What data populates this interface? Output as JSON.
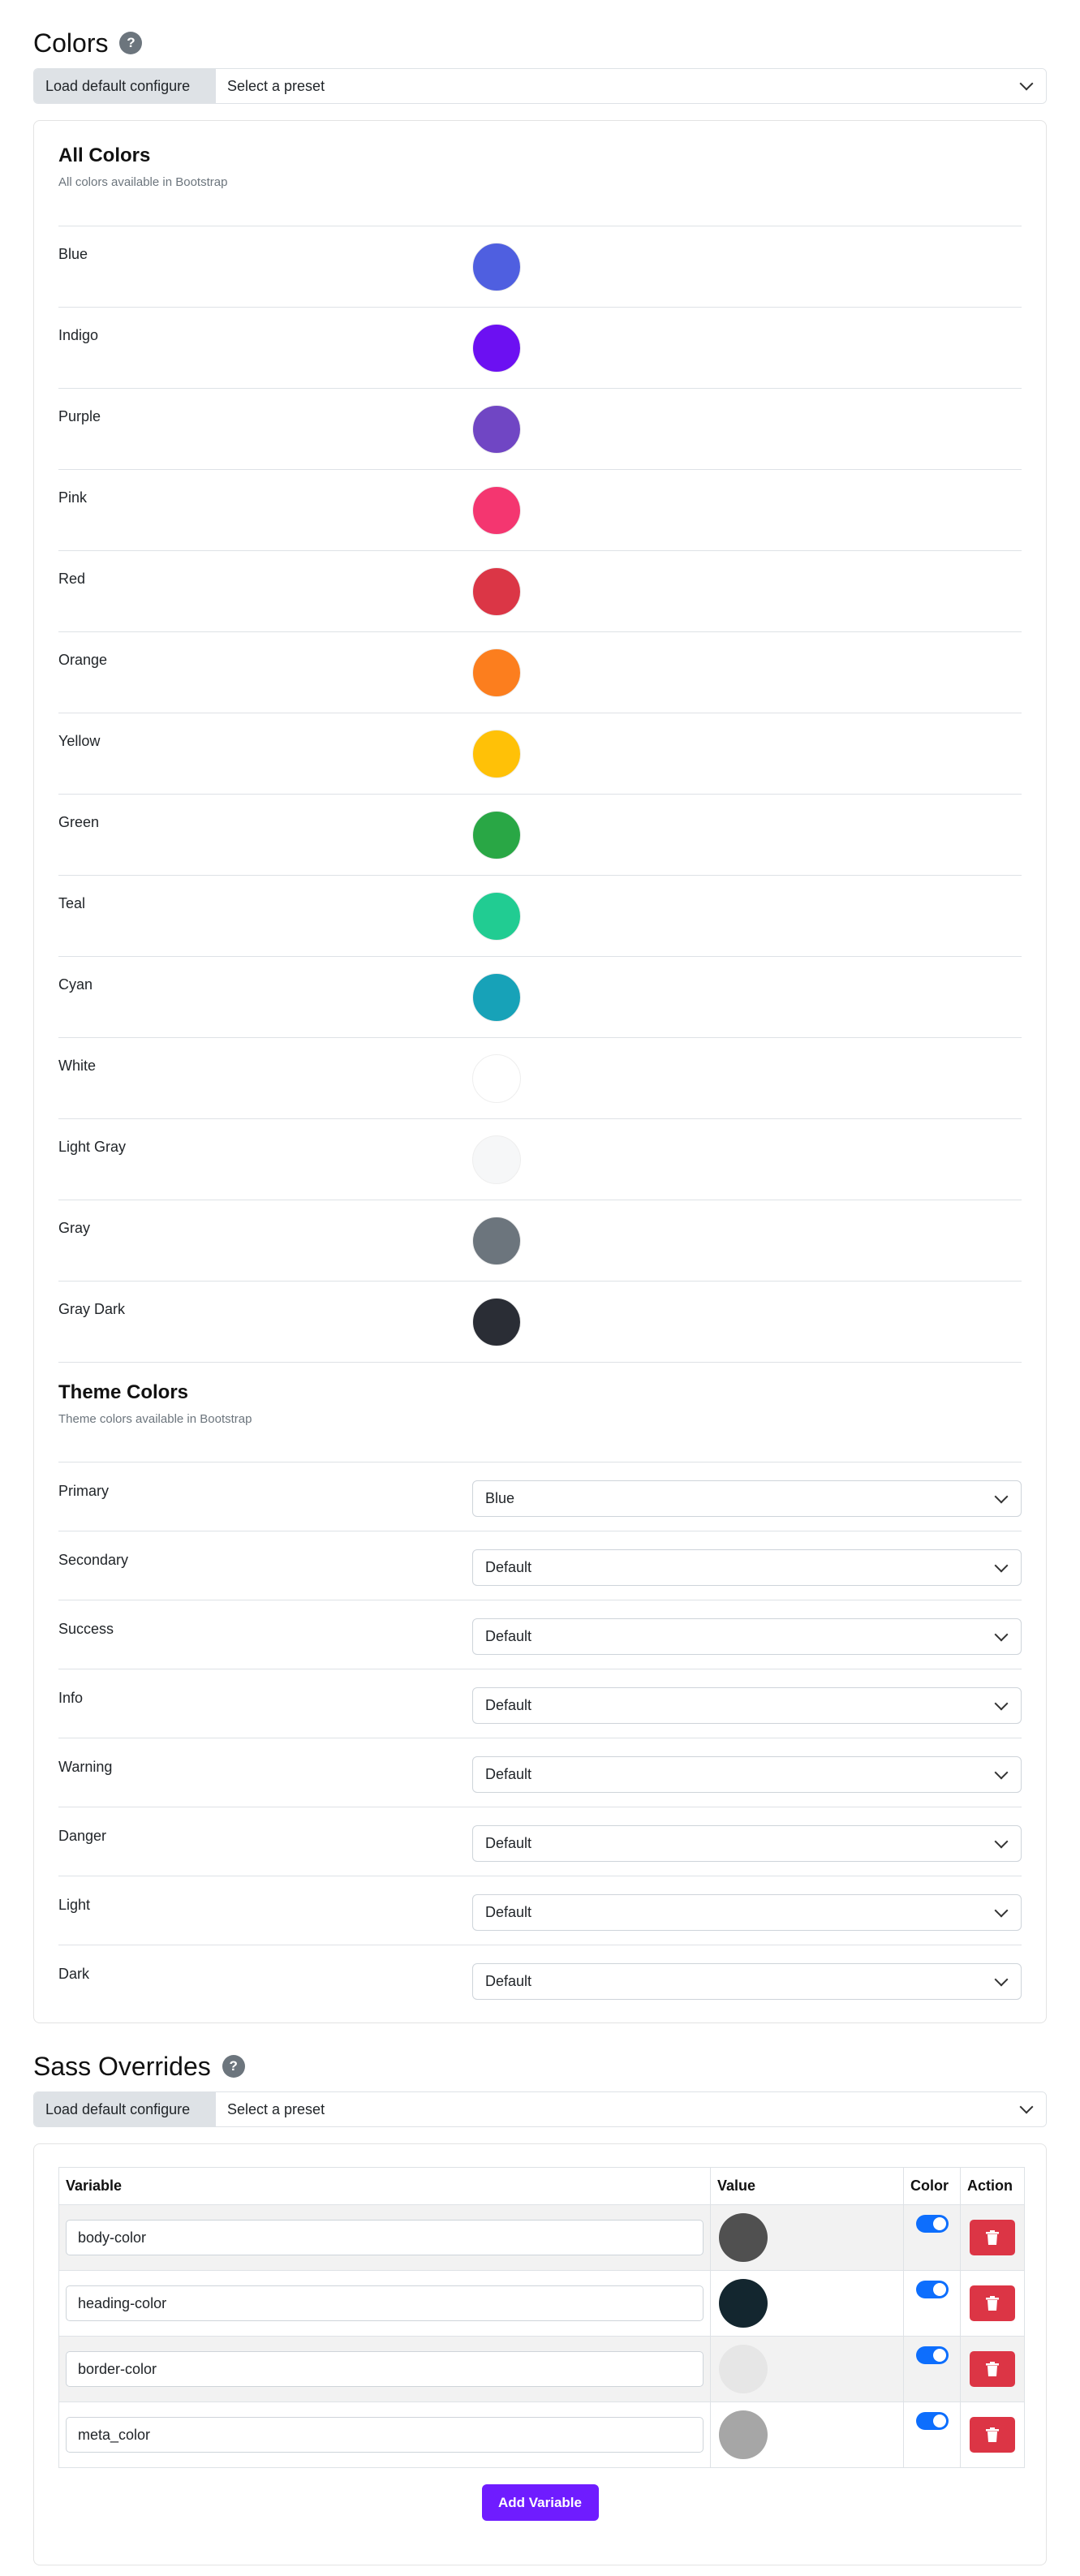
{
  "colors_section": {
    "title": "Colors",
    "help": "?",
    "preset": {
      "button_label": "Load default configure",
      "select_value": "Select a preset"
    },
    "all_colors": {
      "title": "All Colors",
      "subtitle": "All colors available in Bootstrap",
      "items": [
        {
          "label": "Blue",
          "color": "#4f5fe0"
        },
        {
          "label": "Indigo",
          "color": "#6c10f2"
        },
        {
          "label": "Purple",
          "color": "#7046c4"
        },
        {
          "label": "Pink",
          "color": "#f43670"
        },
        {
          "label": "Red",
          "color": "#db3646"
        },
        {
          "label": "Orange",
          "color": "#fc7e1e"
        },
        {
          "label": "Yellow",
          "color": "#ffc107"
        },
        {
          "label": "Green",
          "color": "#29a745"
        },
        {
          "label": "Teal",
          "color": "#21cc92"
        },
        {
          "label": "Cyan",
          "color": "#17a2b8"
        },
        {
          "label": "White",
          "color": "#ffffff"
        },
        {
          "label": "Light Gray",
          "color": "#f6f7f8"
        },
        {
          "label": "Gray",
          "color": "#6c757d"
        },
        {
          "label": "Gray Dark",
          "color": "#2a2d35"
        }
      ]
    },
    "theme_colors": {
      "title": "Theme Colors",
      "subtitle": "Theme colors available in Bootstrap",
      "items": [
        {
          "label": "Primary",
          "value": "Blue"
        },
        {
          "label": "Secondary",
          "value": "Default"
        },
        {
          "label": "Success",
          "value": "Default"
        },
        {
          "label": "Info",
          "value": "Default"
        },
        {
          "label": "Warning",
          "value": "Default"
        },
        {
          "label": "Danger",
          "value": "Default"
        },
        {
          "label": "Light",
          "value": "Default"
        },
        {
          "label": "Dark",
          "value": "Default"
        }
      ]
    }
  },
  "sass_section": {
    "title": "Sass Overrides",
    "help": "?",
    "preset": {
      "button_label": "Load default configure",
      "select_value": "Select a preset"
    },
    "table": {
      "headers": {
        "variable": "Variable",
        "value": "Value",
        "color": "Color",
        "action": "Action"
      },
      "rows": [
        {
          "variable": "body-color",
          "value_color": "#505050",
          "color_enabled": true
        },
        {
          "variable": "heading-color",
          "value_color": "#13262f",
          "color_enabled": true
        },
        {
          "variable": "border-color",
          "value_color": "#e6e6e6",
          "color_enabled": true
        },
        {
          "variable": "meta_color",
          "value_color": "#a6a6a6",
          "color_enabled": true
        }
      ]
    },
    "add_button": "Add Variable"
  },
  "colors": {
    "accent": "#6f1cff",
    "toggle_on": "#0d6efd",
    "danger": "#dc3545",
    "help_icon": "#6c757d"
  }
}
